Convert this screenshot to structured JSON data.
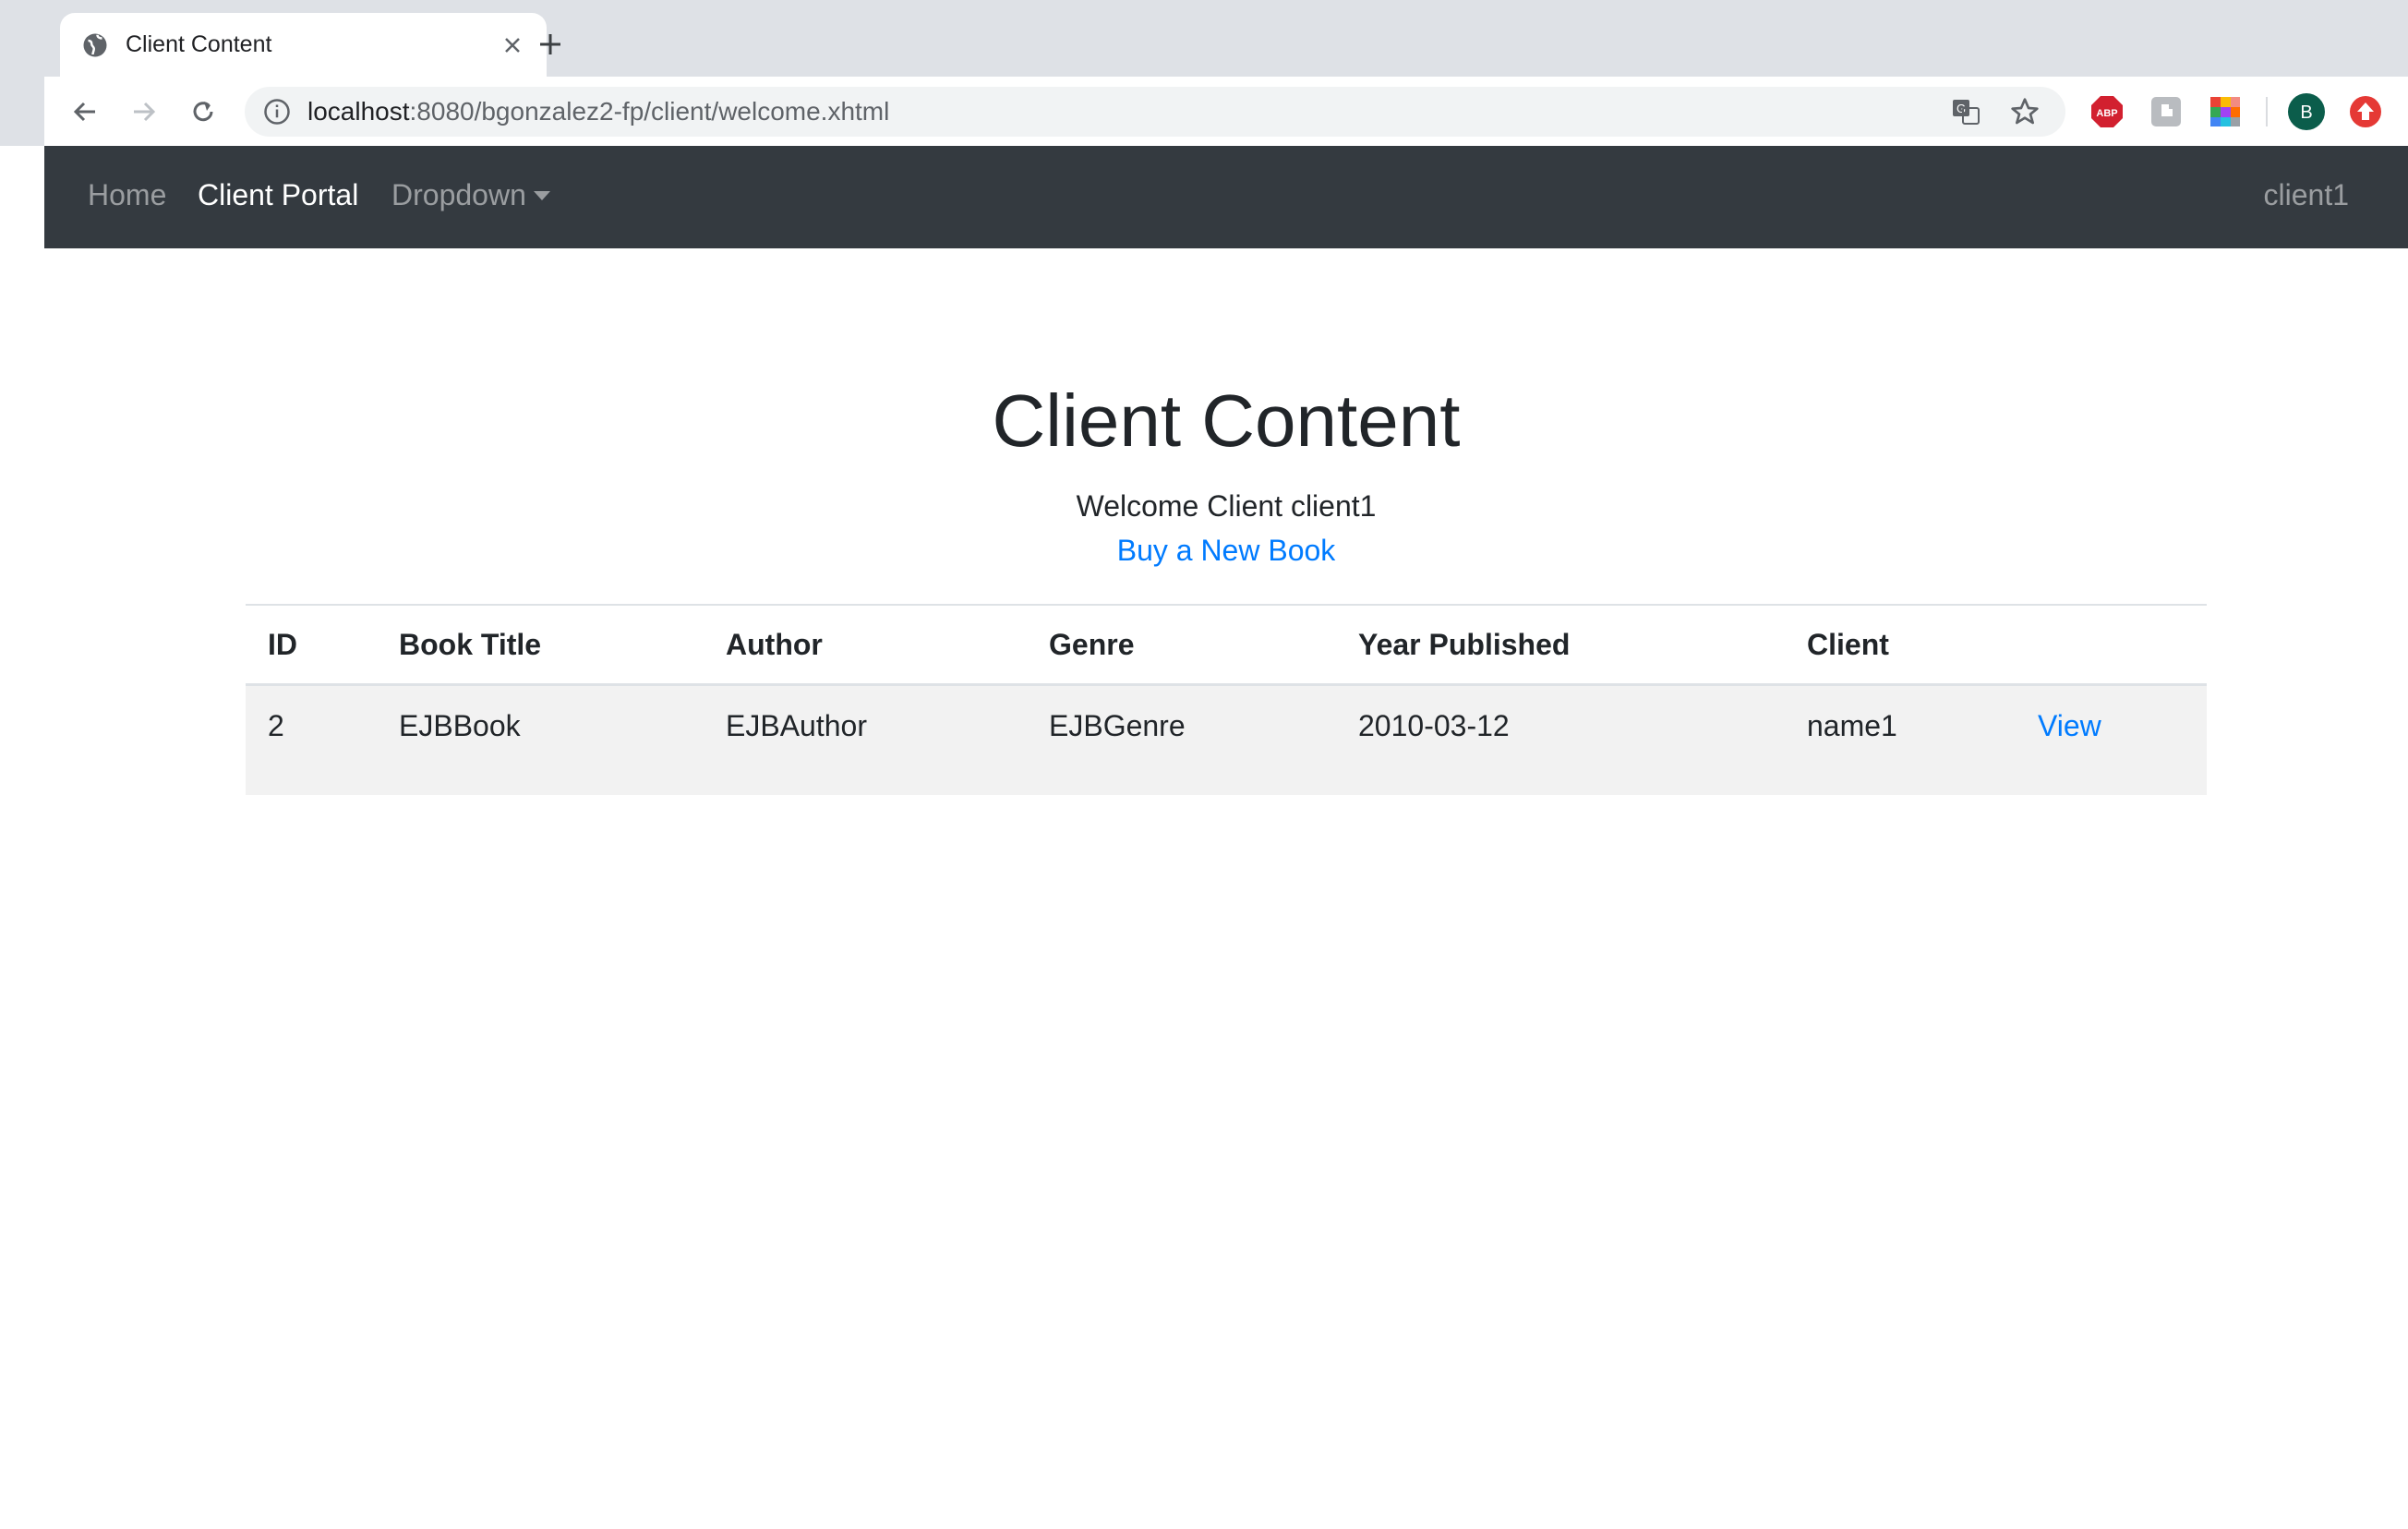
{
  "browser": {
    "tab_title": "Client Content",
    "url_host": "localhost",
    "url_path": ":8080/bgonzalez2-fp/client/welcome.xhtml",
    "profile_initial": "B",
    "extensions": [
      "ABP"
    ]
  },
  "navbar": {
    "items": [
      {
        "label": "Home",
        "active": false
      },
      {
        "label": "Client Portal",
        "active": true
      },
      {
        "label": "Dropdown",
        "active": false
      }
    ],
    "user": "client1"
  },
  "main": {
    "title": "Client Content",
    "welcome": "Welcome Client client1",
    "buy_link": "Buy a New Book"
  },
  "table": {
    "columns": [
      "ID",
      "Book Title",
      "Author",
      "Genre",
      "Year Published",
      "Client",
      ""
    ],
    "rows": [
      {
        "id": "2",
        "title": "EJBBook",
        "author": "EJBAuthor",
        "genre": "EJBGenre",
        "year": "2010-03-12",
        "client": "name1",
        "action": "View"
      }
    ]
  },
  "colors": {
    "navbar_bg": "#343a40",
    "link": "#007bff",
    "chrome_bg": "#dee1e6"
  }
}
